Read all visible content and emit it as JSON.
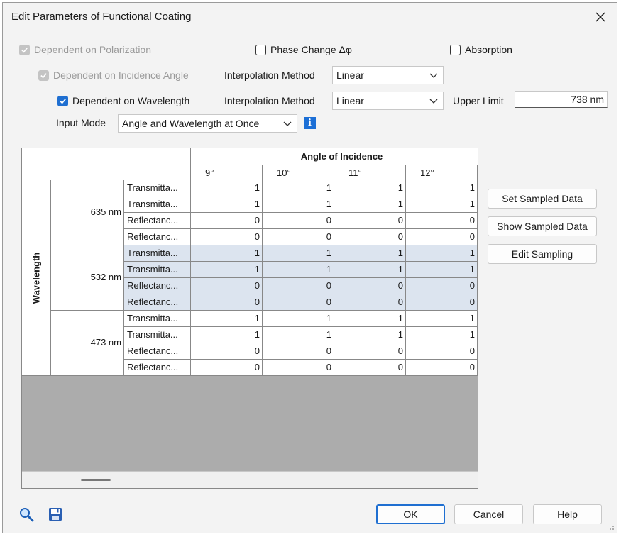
{
  "window": {
    "title": "Edit Parameters of Functional Coating"
  },
  "options": {
    "dep_polarization": {
      "label": "Dependent on Polarization",
      "checked": true,
      "enabled": false
    },
    "phase_change": {
      "label": "Phase Change Δφ",
      "checked": false
    },
    "absorption": {
      "label": "Absorption",
      "checked": false
    },
    "dep_incidence": {
      "label": "Dependent on Incidence Angle",
      "checked": true,
      "enabled": false
    },
    "dep_wavelength": {
      "label": "Dependent on Wavelength",
      "checked": true,
      "enabled": true
    }
  },
  "interp_angle": {
    "label": "Interpolation Method",
    "value": "Linear"
  },
  "interp_wavelength": {
    "label": "Interpolation Method",
    "value": "Linear"
  },
  "upper_limit": {
    "label": "Upper Limit",
    "value": "738 nm"
  },
  "input_mode": {
    "label": "Input Mode",
    "value": "Angle and Wavelength at Once"
  },
  "table": {
    "angle_header": "Angle of Incidence",
    "wavelength_header": "Wavelength",
    "angles": [
      "9°",
      "10°",
      "11°",
      "12°"
    ],
    "groups": [
      {
        "wavelength": "635 nm",
        "rows": [
          {
            "label": "Transmitta...",
            "values": [
              "1",
              "1",
              "1",
              "1"
            ]
          },
          {
            "label": "Transmitta...",
            "values": [
              "1",
              "1",
              "1",
              "1"
            ]
          },
          {
            "label": "Reflectanc...",
            "values": [
              "0",
              "0",
              "0",
              "0"
            ]
          },
          {
            "label": "Reflectanc...",
            "values": [
              "0",
              "0",
              "0",
              "0"
            ]
          }
        ]
      },
      {
        "wavelength": "532 nm",
        "rows": [
          {
            "label": "Transmitta...",
            "values": [
              "1",
              "1",
              "1",
              "1"
            ]
          },
          {
            "label": "Transmitta...",
            "values": [
              "1",
              "1",
              "1",
              "1"
            ]
          },
          {
            "label": "Reflectanc...",
            "values": [
              "0",
              "0",
              "0",
              "0"
            ]
          },
          {
            "label": "Reflectanc...",
            "values": [
              "0",
              "0",
              "0",
              "0"
            ]
          }
        ]
      },
      {
        "wavelength": "473 nm",
        "rows": [
          {
            "label": "Transmitta...",
            "values": [
              "1",
              "1",
              "1",
              "1"
            ]
          },
          {
            "label": "Transmitta...",
            "values": [
              "1",
              "1",
              "1",
              "1"
            ]
          },
          {
            "label": "Reflectanc...",
            "values": [
              "0",
              "0",
              "0",
              "0"
            ]
          },
          {
            "label": "Reflectanc...",
            "values": [
              "0",
              "0",
              "0",
              "0"
            ]
          }
        ]
      }
    ]
  },
  "side_buttons": {
    "set_sampled": "Set Sampled Data",
    "show_sampled": "Show Sampled Data",
    "edit_sampling": "Edit Sampling"
  },
  "footer": {
    "ok": "OK",
    "cancel": "Cancel",
    "help": "Help"
  },
  "icons": {
    "zoom": "zoom-icon",
    "save": "save-icon",
    "info": "info-icon"
  },
  "colors": {
    "accent": "#1f6fd1",
    "selection": "#dce4ef"
  }
}
